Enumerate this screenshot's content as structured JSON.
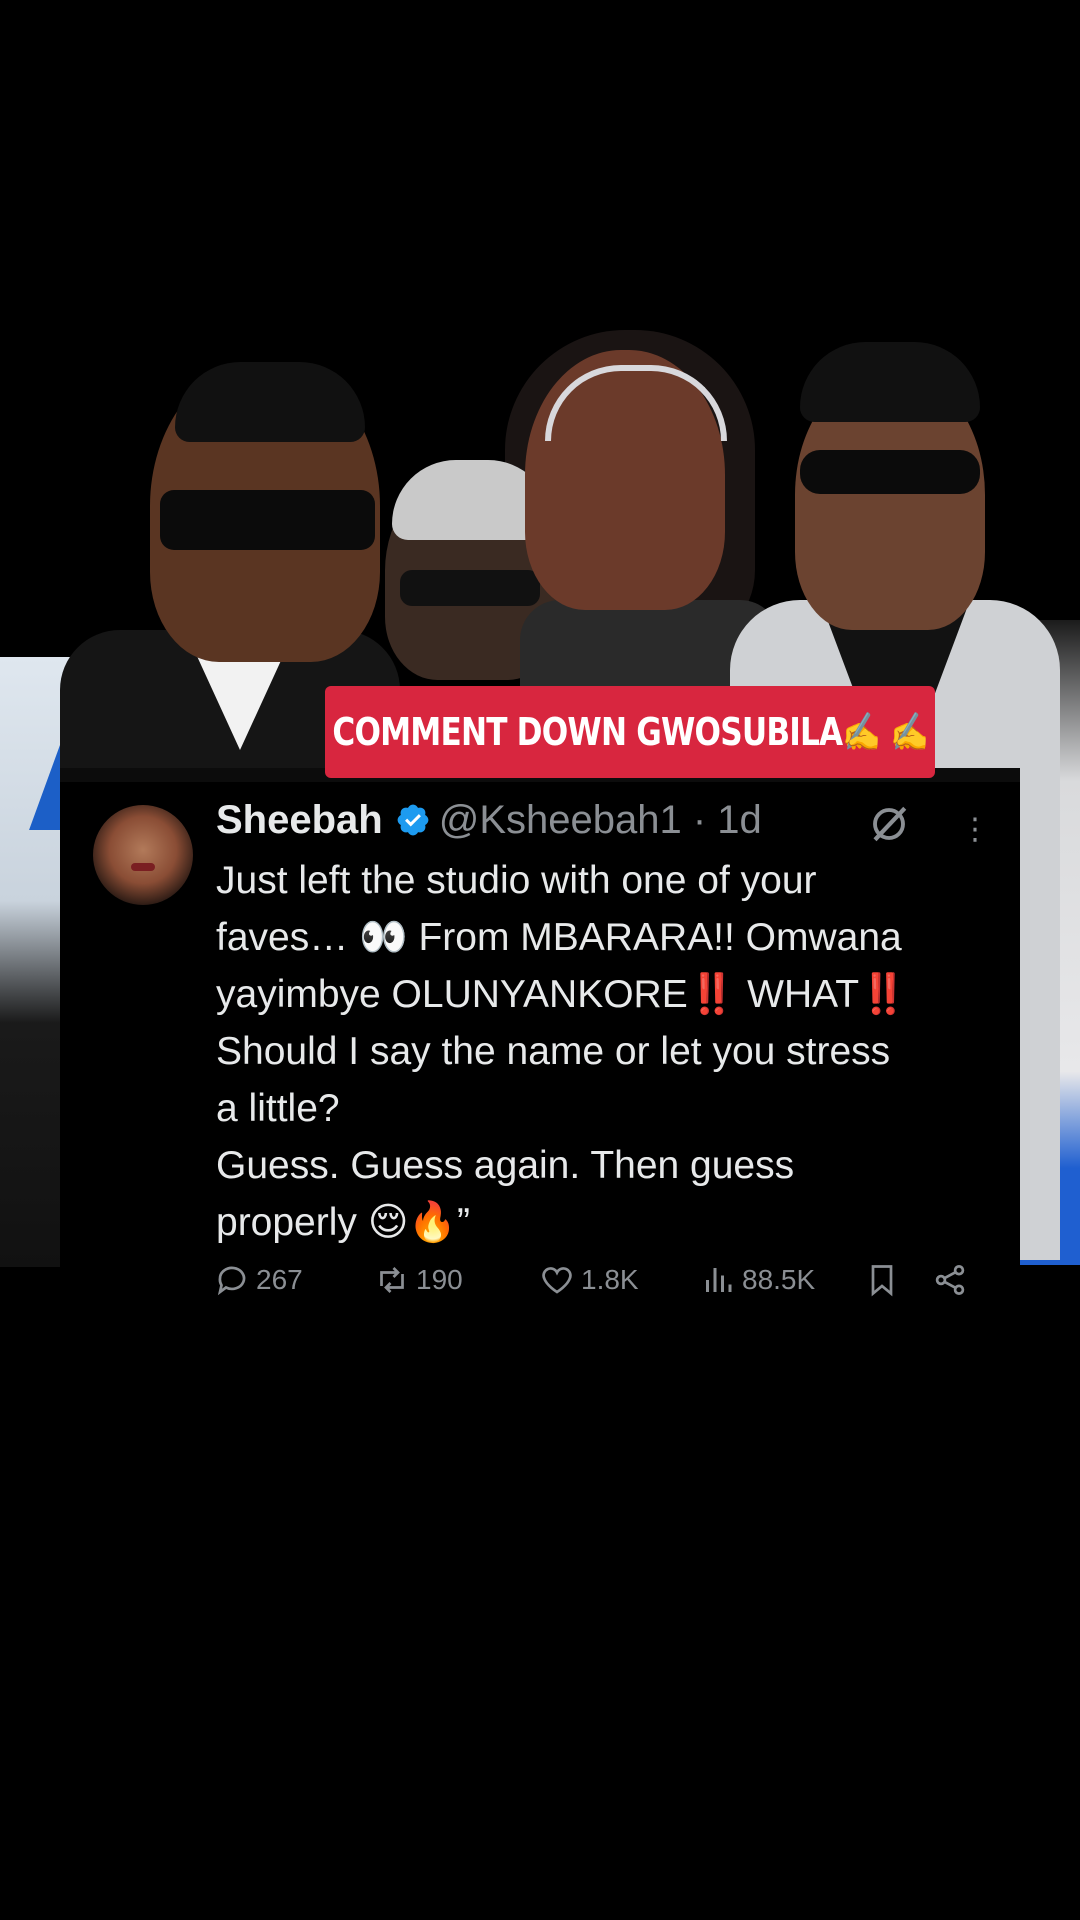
{
  "banner": {
    "text": "COMMENT DOWN GWOSUBILA✍️ ✍️"
  },
  "tweet": {
    "author_name": "Sheebah",
    "handle_time": "@Ksheebah1 · 1d",
    "text": "Just left the studio with one of your\nfaves… 👀 From MBARARA!! Omwana\nyayimbye OLUNYANKORE‼️ WHAT‼️\nShould I say the name or let you stress\na little?\nGuess. Guess again. Then guess\nproperly 😌🔥”",
    "replies": "267",
    "reposts": "190",
    "likes": "1.8K",
    "views": "88.5K"
  },
  "colors": {
    "banner": "#d8263f",
    "verified": "#1d9bf0",
    "muted_text": "#8b8f94"
  },
  "icons": [
    "verified-badge-icon",
    "grok-icon",
    "more-icon",
    "reply-icon",
    "repost-icon",
    "like-icon",
    "views-icon",
    "bookmark-icon",
    "share-icon"
  ]
}
